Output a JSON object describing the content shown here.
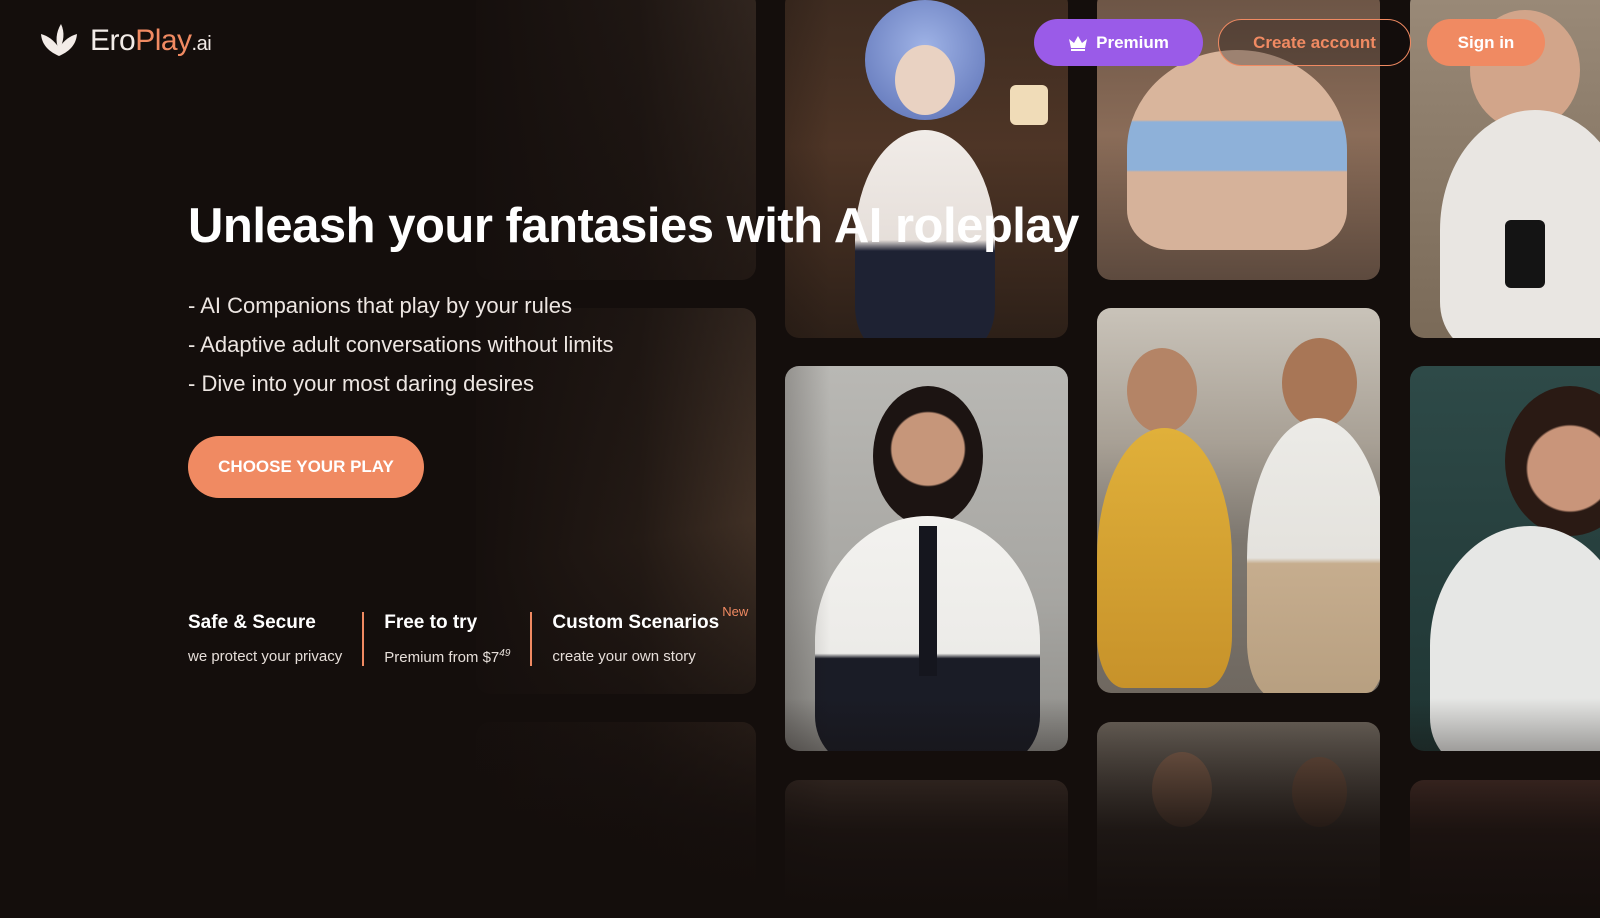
{
  "brand": {
    "name_part1": "Ero",
    "name_part2": "Play",
    "name_tld": ".ai",
    "accent": "#f08a62",
    "premium_color": "#9a5be8"
  },
  "nav": {
    "premium_label": "Premium",
    "premium_icon": "crown-icon",
    "create_account_label": "Create account",
    "sign_in_label": "Sign in"
  },
  "hero": {
    "title": "Unleash your fantasies with AI roleplay",
    "bullets": [
      "- AI Companions that play by your rules",
      "- Adaptive adult conversations without limits",
      "- Dive into your most daring desires"
    ],
    "cta_label": "CHOOSE YOUR PLAY"
  },
  "features": [
    {
      "title": "Safe & Secure",
      "subtitle": "we protect your privacy"
    },
    {
      "title": "Free to try",
      "subtitle": "Premium from $7",
      "price_cents": "49"
    },
    {
      "title": "Custom Scenarios",
      "badge": "New",
      "subtitle": "create your own story"
    }
  ]
}
